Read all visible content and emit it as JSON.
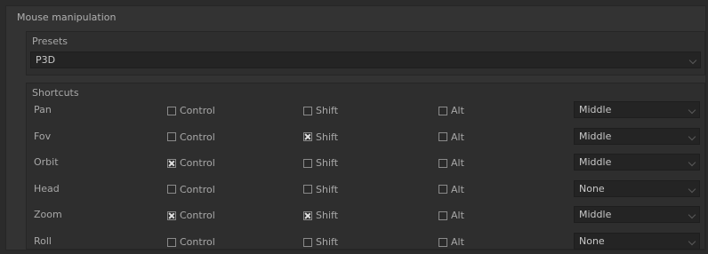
{
  "panel": {
    "title": "Mouse manipulation"
  },
  "presets": {
    "label": "Presets",
    "value": "P3D"
  },
  "shortcuts": {
    "label": "Shortcuts",
    "modifier_labels": {
      "control": "Control",
      "shift": "Shift",
      "alt": "Alt"
    },
    "rows": [
      {
        "label": "Pan",
        "control": false,
        "shift": false,
        "alt": false,
        "button": "Middle"
      },
      {
        "label": "Fov",
        "control": false,
        "shift": true,
        "alt": false,
        "button": "Middle"
      },
      {
        "label": "Orbit",
        "control": true,
        "shift": false,
        "alt": false,
        "button": "Middle"
      },
      {
        "label": "Head",
        "control": false,
        "shift": false,
        "alt": false,
        "button": "None"
      },
      {
        "label": "Zoom",
        "control": true,
        "shift": true,
        "alt": false,
        "button": "Middle"
      },
      {
        "label": "Roll",
        "control": false,
        "shift": false,
        "alt": false,
        "button": "None"
      }
    ]
  },
  "colors": {
    "background": "#333333",
    "field": "#242424",
    "text": "#a8a8a8",
    "check": "#e0e0e0"
  },
  "icons": {
    "dropdown": "chevron-down-icon",
    "checkbox_checked": "x-check-icon"
  }
}
